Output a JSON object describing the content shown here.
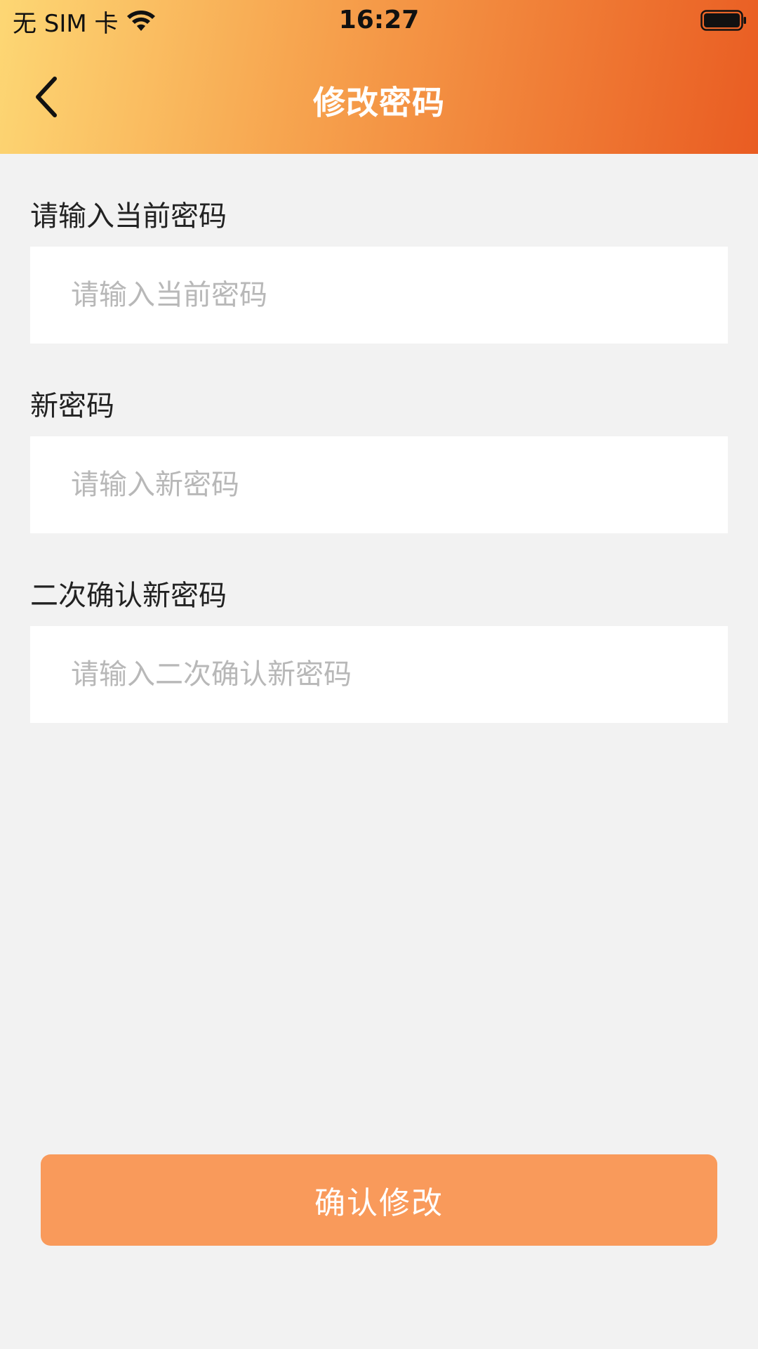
{
  "status_bar": {
    "carrier": "无 SIM 卡",
    "time": "16:27",
    "battery_level": 1.0
  },
  "nav": {
    "title": "修改密码",
    "back_icon": "chevron-left-icon"
  },
  "form": {
    "current_password": {
      "label": "请输入当前密码",
      "placeholder": "请输入当前密码",
      "value": ""
    },
    "new_password": {
      "label": "新密码",
      "placeholder": "请输入新密码",
      "value": ""
    },
    "confirm_password": {
      "label": "二次确认新密码",
      "placeholder": "请输入二次确认新密码",
      "value": ""
    }
  },
  "submit": {
    "label": "确认修改"
  },
  "colors": {
    "header_gradient_start": "#fdd774",
    "header_gradient_end": "#e95c22",
    "button": "#f99a5b",
    "background": "#f2f2f2",
    "placeholder": "#b8b8b8"
  }
}
